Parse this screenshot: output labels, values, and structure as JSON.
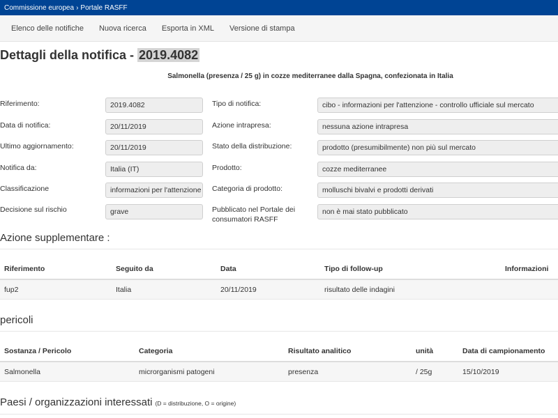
{
  "breadcrumb": {
    "home": "Commissione europea",
    "separator": "›",
    "current": "Portale RASFF"
  },
  "nav": {
    "items": [
      "Elenco delle notifiche",
      "Nuova ricerca",
      "Esporta in XML",
      "Versione di stampa"
    ]
  },
  "page": {
    "title_prefix": "Dettagli della notifica - ",
    "reference": "2019.4082",
    "subject": "Salmonella (presenza / 25 g) in cozze mediterranee dalla Spagna, confezionata in Italia"
  },
  "details_left": [
    {
      "label": "Riferimento:",
      "value": "2019.4082"
    },
    {
      "label": "Data di notifica:",
      "value": "20/11/2019"
    },
    {
      "label": "Ultimo aggiornamento:",
      "value": "20/11/2019"
    },
    {
      "label": "Notifica da:",
      "value": "Italia (IT)"
    },
    {
      "label": "Classificazione",
      "value": "informazioni per l'attenzione"
    },
    {
      "label": "Decisione sul rischio",
      "value": "grave"
    }
  ],
  "details_right": [
    {
      "label": "Tipo di notifica:",
      "value": "cibo - informazioni per l'attenzione - controllo ufficiale sul mercato"
    },
    {
      "label": "Azione intrapresa:",
      "value": "nessuna azione intrapresa"
    },
    {
      "label": "Stato della distribuzione:",
      "value": "prodotto (presumibilmente) non più sul mercato"
    },
    {
      "label": "Prodotto:",
      "value": "cozze mediterranee"
    },
    {
      "label": "Categoria di prodotto:",
      "value": "molluschi bivalvi e prodotti derivati"
    },
    {
      "label": "Pubblicato nel Portale dei consumatori RASFF",
      "value": "non è mai stato pubblicato"
    }
  ],
  "followup": {
    "title": "Azione supplementare :",
    "headers": [
      "Riferimento",
      "Seguito da",
      "Data",
      "Tipo di follow-up",
      "Informazioni"
    ],
    "rows": [
      [
        "fup2",
        "Italia",
        "20/11/2019",
        "risultato delle indagini",
        ""
      ]
    ]
  },
  "hazards": {
    "title": "pericoli",
    "headers": [
      "Sostanza / Pericolo",
      "Categoria",
      "Risultato analitico",
      "unità",
      "Data di campionamento"
    ],
    "rows": [
      [
        "Salmonella",
        "microrganismi patogeni",
        "presenza",
        "/ 25g",
        "15/10/2019"
      ]
    ]
  },
  "countries": {
    "title": "Paesi / organizzazioni interessati",
    "note": "(D = distribuzione, O = origine)"
  }
}
